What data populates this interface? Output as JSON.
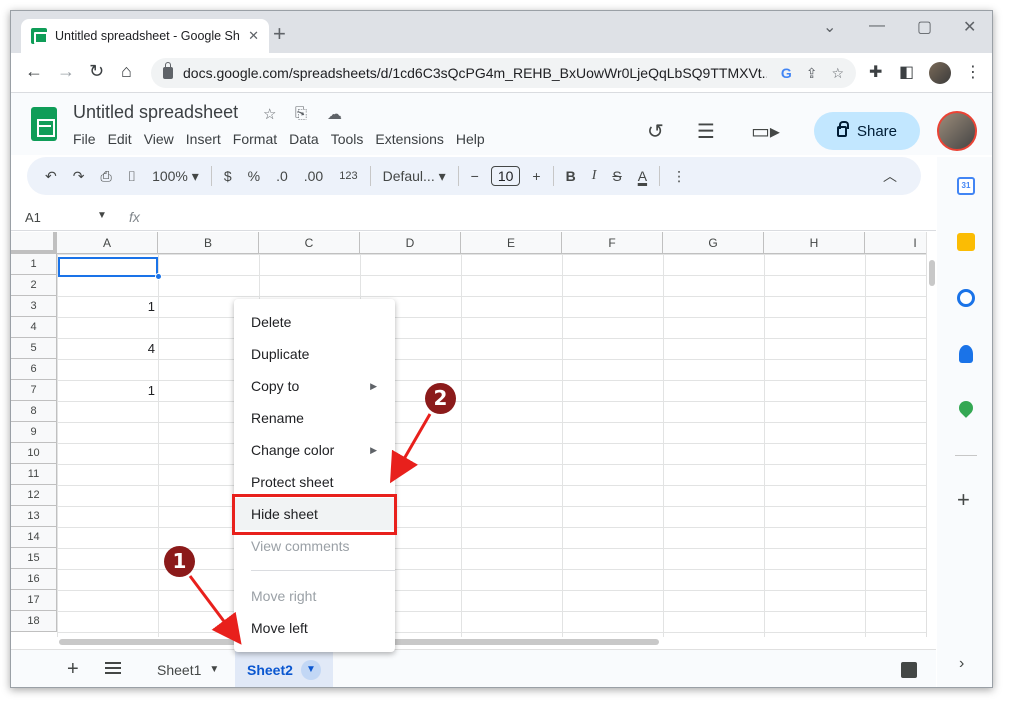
{
  "browser": {
    "tab_title": "Untitled spreadsheet - Google Sh",
    "new_tab": "+",
    "close_tab": "✕",
    "window_controls": [
      "⌄",
      "—",
      "▢",
      "✕"
    ],
    "nav": {
      "back": "←",
      "forward": "→",
      "reload": "↻",
      "home": "⌂"
    },
    "url": "docs.google.com/spreadsheets/d/1cd6C3sQcPG4m_REHB_BxUowWr0LjeQqLbSQ9TTMXVt...",
    "omnibox_icons": [
      "google-lens-icon",
      "share-icon",
      "star-icon"
    ],
    "extension_icons": [
      "puzzle-icon",
      "sidebar-icon",
      "menu-dots-icon"
    ]
  },
  "app": {
    "title": "Untitled spreadsheet",
    "menu": [
      "File",
      "Edit",
      "View",
      "Insert",
      "Format",
      "Data",
      "Tools",
      "Extensions",
      "Help"
    ],
    "share_label": "Share"
  },
  "toolbar": {
    "zoom": "100%",
    "currency": "$",
    "percent": "%",
    "dec_decrease": ".0",
    "dec_increase": ".00",
    "number_format": "123",
    "font": "Defaul...",
    "font_size": "10",
    "minus": "−",
    "plus": "+",
    "bold": "B",
    "italic": "I",
    "strike": "S",
    "text_color": "A"
  },
  "formula_bar": {
    "name_box": "A1",
    "fx": "fx"
  },
  "grid": {
    "columns": [
      "A",
      "B",
      "C",
      "D",
      "E",
      "F",
      "G",
      "H",
      "I"
    ],
    "rows": [
      "1",
      "2",
      "3",
      "4",
      "5",
      "6",
      "7",
      "8",
      "9",
      "10",
      "11",
      "12",
      "13",
      "14",
      "15",
      "16",
      "17",
      "18"
    ],
    "values": [
      {
        "row": 3,
        "col": "A",
        "value": "1"
      },
      {
        "row": 5,
        "col": "A",
        "value": "4"
      },
      {
        "row": 7,
        "col": "A",
        "value": "1"
      }
    ],
    "selected_cell": "A1"
  },
  "side_panel": {
    "calendar_day": "31",
    "add": "+",
    "expand": "›"
  },
  "sheets": {
    "add": "+",
    "tabs": [
      {
        "name": "Sheet1",
        "active": false
      },
      {
        "name": "Sheet2",
        "active": true
      }
    ]
  },
  "context_menu": {
    "items": [
      {
        "label": "Delete",
        "disabled": false
      },
      {
        "label": "Duplicate",
        "disabled": false
      },
      {
        "label": "Copy to",
        "disabled": false,
        "submenu": true
      },
      {
        "label": "Rename",
        "disabled": false
      },
      {
        "label": "Change color",
        "disabled": false,
        "submenu": true
      },
      {
        "label": "Protect sheet",
        "disabled": false
      },
      {
        "label": "Hide sheet",
        "disabled": false,
        "highlighted": true
      },
      {
        "label": "View comments",
        "disabled": true
      }
    ],
    "items_after_separator": [
      {
        "label": "Move right",
        "disabled": true
      },
      {
        "label": "Move left",
        "disabled": false
      }
    ]
  },
  "annotations": {
    "step1": "1",
    "step2": "2",
    "color": "#e8201c",
    "badge_color": "#8b1a1a"
  },
  "colors": {
    "accent": "#1a73e8",
    "share_bg": "#c2e7ff",
    "sheets_green": "#0f9d58",
    "active_tab": "#0b57d0"
  }
}
